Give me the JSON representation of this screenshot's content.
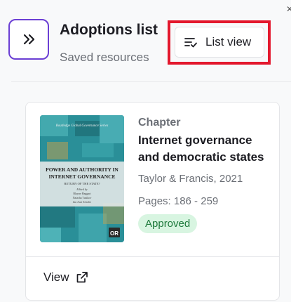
{
  "header": {
    "title": "Adoptions list",
    "subtitle": "Saved resources",
    "list_view_label": "List view",
    "expand_icon": "double-chevron-right-icon",
    "list_icon": "list-check-icon"
  },
  "colors": {
    "accent": "#6b3fd4",
    "highlight": "#e3182d",
    "badge_bg": "#d8f5e1",
    "badge_text": "#1e7a3c"
  },
  "card": {
    "type": "Chapter",
    "title": "Internet governance and democratic states",
    "publisher": "Taylor & Francis, 2021",
    "pages": "Pages: 186 - 259",
    "status": "Approved",
    "view_label": "View",
    "cover": {
      "series": "Routledge Global Governance Series",
      "title": "POWER AND AUTHORITY IN INTERNET GOVERNANCE",
      "subtitle": "RETURN OF THE STATE?",
      "edited_by": "Edited by",
      "editors": [
        "Blayne Haggart",
        "Natasha Tusikov",
        "Jan Aart Scholte"
      ],
      "logo": "OR"
    }
  }
}
